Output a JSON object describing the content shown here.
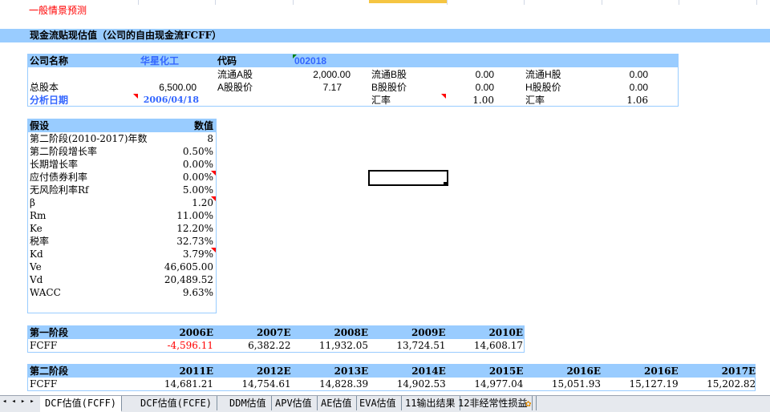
{
  "scenario_label": "一般情景预测",
  "section_title": "现金流贴现估值（公司的自由现金流FCFF）",
  "company": {
    "name_label": "公司名称",
    "name": "华星化工",
    "code_label": "代码",
    "code": "002018",
    "float_a_label": "流通A股",
    "float_a": "2,000.00",
    "float_b_label": "流通B股",
    "float_b": "0.00",
    "float_h_label": "流通H股",
    "float_h": "0.00",
    "total_shares_label": "总股本",
    "total_shares": "6,500.00",
    "a_price_label": "A股股价",
    "a_price": "7.17",
    "b_price_label": "B股股价",
    "b_price": "0.00",
    "h_price_label": "H股股价",
    "h_price": "0.00",
    "date_label": "分析日期",
    "date": "2006/04/18",
    "fx_b_label": "汇率",
    "fx_b": "1.00",
    "fx_h_label": "汇率",
    "fx_h": "1.06"
  },
  "assumptions": {
    "header": [
      "假设",
      "数值"
    ],
    "rows": [
      [
        "第二阶段(2010-2017)年数",
        "8"
      ],
      [
        "第二阶段增长率",
        "0.50%"
      ],
      [
        "长期增长率",
        "0.00%"
      ],
      [
        "应付债券利率",
        "0.00%"
      ],
      [
        "无风险利率Rf",
        "5.00%"
      ],
      [
        "β",
        "1.20"
      ],
      [
        "Rm",
        "11.00%"
      ],
      [
        "Ke",
        "12.20%"
      ],
      [
        "税率",
        "32.73%"
      ],
      [
        "Kd",
        "3.79%"
      ],
      [
        "Ve",
        "46,605.00"
      ],
      [
        "Vd",
        "20,489.52"
      ],
      [
        "WACC",
        "9.63%"
      ]
    ]
  },
  "stage1": {
    "label": "第一阶段",
    "row_label": "FCFF",
    "years": [
      "2006E",
      "2007E",
      "2008E",
      "2009E",
      "2010E"
    ],
    "values": [
      "-4,596.11",
      "6,382.22",
      "11,932.05",
      "13,724.51",
      "14,608.17"
    ]
  },
  "stage2": {
    "label": "第二阶段",
    "row_label": "FCFF",
    "years": [
      "2011E",
      "2012E",
      "2013E",
      "2014E",
      "2015E",
      "2016E",
      "2016E",
      "2017E"
    ],
    "values": [
      "14,681.21",
      "14,754.61",
      "14,828.39",
      "14,902.53",
      "14,977.04",
      "15,051.93",
      "15,127.19",
      "15,202.82"
    ]
  },
  "sheet_tabs": [
    "DCF估值(FCFF)",
    "DCF估值(FCFE)",
    "DDM估值",
    "APV估值",
    "AE估值",
    "EVA估值",
    "11输出结果",
    "12非经常性损益"
  ]
}
